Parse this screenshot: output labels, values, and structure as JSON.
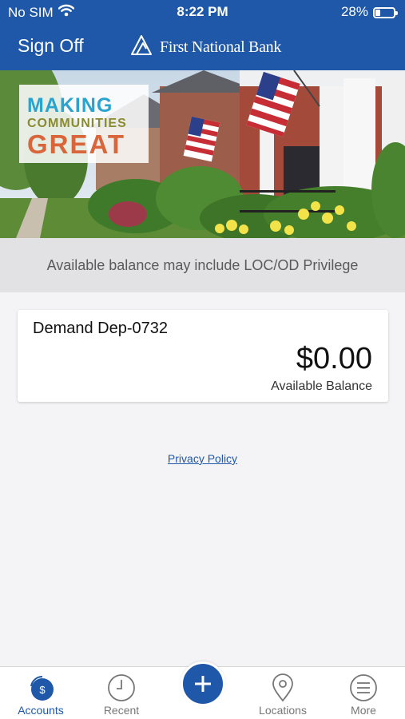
{
  "status_bar": {
    "carrier": "No SIM",
    "time": "8:22 PM",
    "battery": "28%",
    "battery_level": 0.28
  },
  "header": {
    "sign_off": "Sign Off",
    "brand": "First National Bank"
  },
  "banner": {
    "line1": "MAKING",
    "line2": "COMMUNITIES",
    "line3": "GREAT"
  },
  "notice": "Available balance may include LOC/OD Privilege",
  "account": {
    "name": "Demand Dep-0732",
    "amount": "$0.00",
    "label": "Available Balance"
  },
  "privacy_link": "Privacy Policy",
  "tabs": [
    {
      "label": "Accounts",
      "icon": "accounts-icon",
      "active": true
    },
    {
      "label": "Recent",
      "icon": "clock-icon"
    },
    {
      "label": "Locations",
      "icon": "location-pin-icon"
    },
    {
      "label": "More",
      "icon": "menu-icon"
    }
  ],
  "colors": {
    "brand_blue": "#1f58a8",
    "background": "#f4f4f6",
    "notice_bg": "#e2e2e4"
  }
}
